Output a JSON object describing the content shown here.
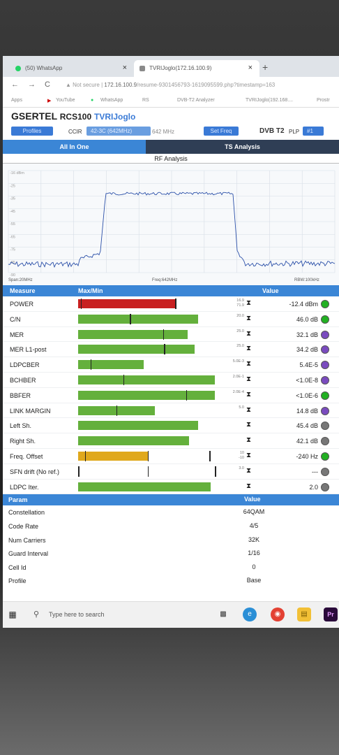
{
  "browser": {
    "tabs": [
      {
        "label": "(50) WhatsApp",
        "close": "×"
      },
      {
        "label": "TVRIJoglo(172.16.100.9)",
        "close": "×"
      }
    ],
    "new_tab": "+",
    "nav": {
      "back": "←",
      "forward": "→",
      "reload": "C"
    },
    "security": "Not secure",
    "url_host": "172.16.100.9",
    "url_path": "/resume-9301456793-1619095599.php?timestamp=163",
    "bookmarks": [
      "Apps",
      "YouTube",
      "WhatsApp",
      "RS",
      "DVB-T2 Analyzer",
      "TVRIJoglo(192.168....",
      "Prostr"
    ]
  },
  "app": {
    "brand": "GSERTEL",
    "model": "RCS100",
    "site": "TVRIJoglo",
    "profiles_btn": "Profiles",
    "standard": "CCIR",
    "channel": "42-3C (642MHz)",
    "freq": "642 MHz",
    "set_freq_btn": "Set Freq",
    "dvb_label": "DVB T2",
    "plp_label": "PLP",
    "plp_value": "#1",
    "tabs": [
      "All In One",
      "TS Analysis"
    ],
    "rf_title": "RF Analysis"
  },
  "spectrum": {
    "ref_label": "-16 dBm",
    "y_ticks": [
      "-16",
      "-25",
      "-35",
      "-45",
      "-55",
      "-65",
      "-75",
      "-85",
      "-90"
    ],
    "span": "Span:20MHz",
    "center": "Freq:642MHz",
    "rbw": "RBW:100kHz"
  },
  "measures": {
    "header": {
      "measure": "Measure",
      "maxmin": "Max/Min",
      "value": "Value"
    },
    "rows": [
      {
        "name": "POWER",
        "fill": 0.71,
        "color": "#c82020",
        "marks": [
          0.02,
          0.71
        ],
        "ref": [
          "16.9",
          "71.9"
        ],
        "value": "-12.4 dBm",
        "led": "#22b022"
      },
      {
        "name": "C/N",
        "fill": 0.88,
        "color": "#64b03c",
        "marks": [
          0.38
        ],
        "ref": [
          "",
          "20.0"
        ],
        "value": "46.0 dB",
        "led": "#22b022"
      },
      {
        "name": "MER",
        "fill": 0.8,
        "color": "#64b03c",
        "marks": [
          0.62
        ],
        "ref": [
          "",
          "25.0"
        ],
        "value": "32.1 dB",
        "led": "#7a4bbf"
      },
      {
        "name": "MER L1-post",
        "fill": 0.85,
        "color": "#64b03c",
        "marks": [
          0.63
        ],
        "ref": [
          "",
          "25.0"
        ],
        "value": "34.2 dB",
        "led": "#7a4bbf"
      },
      {
        "name": "LDPCBER",
        "fill": 0.48,
        "color": "#64b03c",
        "marks": [
          0.09
        ],
        "ref": [
          "",
          "5.0E-3"
        ],
        "value": "5.4E-5",
        "led": "#7a4bbf"
      },
      {
        "name": "BCHBER",
        "fill": 1.0,
        "color": "#64b03c",
        "marks": [
          0.33
        ],
        "ref": [
          "",
          "2.0E-1"
        ],
        "value": "<1.0E-8",
        "led": "#7a4bbf"
      },
      {
        "name": "BBFER",
        "fill": 1.0,
        "color": "#64b03c",
        "marks": [
          0.79
        ],
        "ref": [
          "",
          "2.0E-4"
        ],
        "value": "<1.0E-6",
        "led": "#22b022"
      },
      {
        "name": "LINK MARGIN",
        "fill": 0.56,
        "color": "#64b03c",
        "marks": [
          0.28
        ],
        "ref": [
          "",
          "5.0"
        ],
        "value": "14.8 dB",
        "led": "#7a4bbf"
      },
      {
        "name": "Left Sh.",
        "fill": 0.88,
        "color": "#64b03c",
        "marks": [],
        "ref": [
          "",
          ""
        ],
        "value": "45.4 dB",
        "led": "#777777"
      },
      {
        "name": "Right Sh.",
        "fill": 0.81,
        "color": "#64b03c",
        "marks": [],
        "ref": [
          "",
          ""
        ],
        "value": "42.1 dB",
        "led": "#777777"
      },
      {
        "name": "Freq. Offset",
        "fill": 0.51,
        "color": "#e0a81c",
        "marks": [
          0.05,
          0.51,
          0.96
        ],
        "ref": [
          "10",
          "-10"
        ],
        "value": "-240 Hz",
        "led": "#22b022"
      },
      {
        "name": "SFN drift (No ref.)",
        "fill": 0,
        "color": "#64b03c",
        "marks": [
          0.0,
          0.51,
          1.0
        ],
        "ref": [
          "",
          "3.0"
        ],
        "value": "---",
        "led": "#777777"
      },
      {
        "name": "LDPC Iter.",
        "fill": 0.97,
        "color": "#64b03c",
        "marks": [],
        "ref": [
          "",
          ""
        ],
        "value": "2.0",
        "led": "#777777"
      }
    ]
  },
  "params": {
    "header": {
      "param": "Param",
      "value": "Value"
    },
    "rows": [
      {
        "name": "Constellation",
        "value": "64QAM"
      },
      {
        "name": "Code Rate",
        "value": "4/5"
      },
      {
        "name": "Num Carriers",
        "value": "32K"
      },
      {
        "name": "Guard Interval",
        "value": "1/16"
      },
      {
        "name": "Cell Id",
        "value": "0"
      },
      {
        "name": "Profile",
        "value": "Base"
      }
    ]
  },
  "taskbar": {
    "search_placeholder": "Type here to search",
    "icons": [
      "task-view",
      "edge",
      "chrome",
      "file-explorer",
      "premiere"
    ],
    "premiere_label": "Pr"
  },
  "colors": {
    "accent": "#3b86d6",
    "good": "#64b03c",
    "alarm": "#c82020",
    "warn": "#e0a81c"
  }
}
